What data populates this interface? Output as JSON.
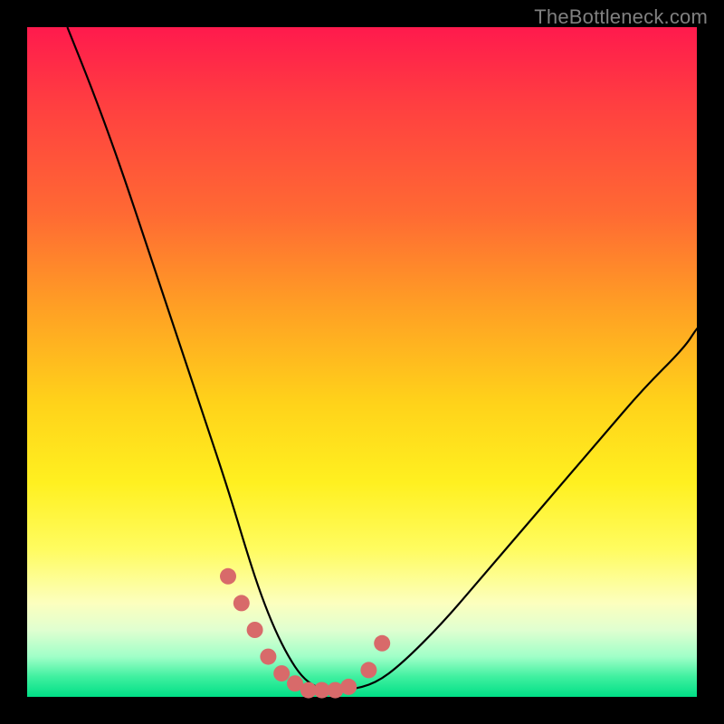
{
  "watermark": "TheBottleneck.com",
  "chart_data": {
    "type": "line",
    "title": "",
    "xlabel": "",
    "ylabel": "",
    "xlim": [
      0,
      100
    ],
    "ylim": [
      0,
      100
    ],
    "series": [
      {
        "name": "bottleneck-curve",
        "stroke": "#000000",
        "stroke_width": 2.2,
        "x": [
          6,
          10,
          14,
          18,
          22,
          26,
          30,
          33,
          35,
          37,
          39,
          41,
          43,
          45,
          48,
          52,
          56,
          62,
          68,
          74,
          80,
          86,
          92,
          98,
          100
        ],
        "y": [
          100,
          90,
          79,
          67,
          55,
          43,
          31,
          21,
          15,
          10,
          6,
          3,
          1.5,
          1,
          1,
          2,
          5,
          11,
          18,
          25,
          32,
          39,
          46,
          52,
          55
        ]
      },
      {
        "name": "highlight-dots",
        "stroke": "#d86a6a",
        "marker_radius": 9,
        "x": [
          30,
          32,
          34,
          36,
          38,
          40,
          42,
          44,
          46,
          48,
          51,
          53
        ],
        "y": [
          18,
          14,
          10,
          6,
          3.5,
          2,
          1,
          1,
          1,
          1.5,
          4,
          8
        ]
      }
    ],
    "background_gradient": {
      "top": "#ff1a4d",
      "upper_mid": "#ffd21a",
      "lower_mid": "#fffc60",
      "bottom": "#00df86"
    }
  }
}
